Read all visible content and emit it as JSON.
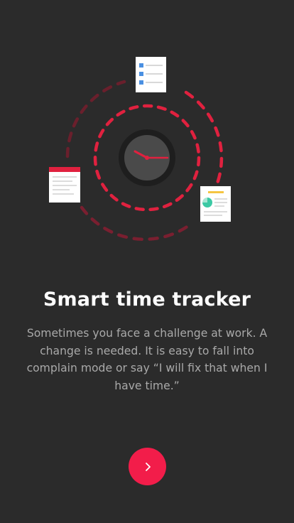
{
  "onboarding": {
    "title": "Smart time tracker",
    "description": "Sometimes you face a challenge at work. A change is needed. It is easy to fall into complain mode or say “I will fix that when I have time.”",
    "next_button_icon": "chevron-right-icon"
  },
  "colors": {
    "background": "#2b2b2b",
    "accent": "#f21d4a",
    "title_text": "#ffffff",
    "body_text": "#a9a9a9",
    "card_blue": "#4a90e2",
    "card_green": "#3cc9a4",
    "card_yellow": "#f5c542"
  }
}
